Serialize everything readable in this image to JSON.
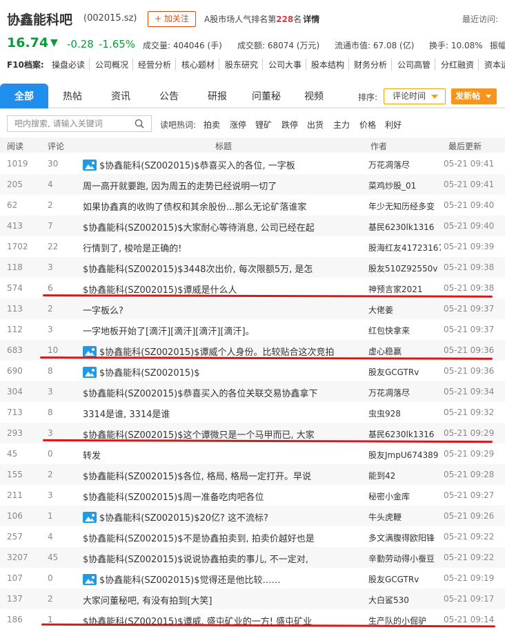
{
  "header": {
    "title": "协鑫能科吧",
    "code": "(002015.sz)",
    "follow_label": "+ 加关注",
    "rank_prefix": "A股市场人气排名第",
    "rank_num": "228",
    "rank_suffix": "名",
    "detail_label": "详情",
    "recent_visit": "最近访问:"
  },
  "quote": {
    "price": "16.74",
    "arrow": "▼",
    "change": "-0.28",
    "change_pct": "-1.65%",
    "volume": "成交量: 404046 (手)",
    "turnover": "成交额: 68074 (万元)",
    "float_cap": "流通市值: 67.08 (亿)",
    "turnover_rate": "换手: 10.08%",
    "amplitude": "振幅"
  },
  "f10": {
    "label": "F10档案:",
    "links": [
      "操盘必读",
      "公司概况",
      "经营分析",
      "核心题材",
      "股东研究",
      "公司大事",
      "股本结构",
      "财务分析",
      "公司高管",
      "分红融资",
      "资本运"
    ]
  },
  "tabs": [
    "全部",
    "热帖",
    "资讯",
    "公告",
    "研报",
    "问董秘",
    "视频"
  ],
  "sort": {
    "label": "排序:",
    "value": "评论时间",
    "post_label": "发新帖"
  },
  "search": {
    "placeholder": "吧内搜索, 请输入关键词",
    "hot_label": "读吧热词:",
    "hot_words": [
      "拍卖",
      "涨停",
      "锂矿",
      "跌停",
      "出货",
      "主力",
      "价格",
      "利好"
    ]
  },
  "table": {
    "headers": [
      "阅读",
      "评论",
      "标题",
      "作者",
      "最后更新"
    ],
    "rows": [
      {
        "read": "1019",
        "cmt": "30",
        "title": "$协鑫能科(SZ002015)$恭喜买入的各位, 一字板",
        "author": "万花凋落尽",
        "time": "05-21 09:41"
      },
      {
        "read": "205",
        "cmt": "4",
        "title": "周一高开就要跑, 因为周五的走势已经说明一切了",
        "author": "菜鸡炒股_01",
        "time": "05-21 09:41"
      },
      {
        "read": "62",
        "cmt": "2",
        "title": "如果协鑫真的收购了债权和其余股份...那么无论矿落谁家",
        "author": "年少无知历经多变",
        "time": "05-21 09:40"
      },
      {
        "read": "413",
        "cmt": "7",
        "title": "$协鑫能科(SZ002015)$大家耐心等待消息, 公司已经在起",
        "author": "基民6230lk1316",
        "time": "05-21 09:40"
      },
      {
        "read": "1702",
        "cmt": "22",
        "title": "行情到了, 梭哈是正确的!",
        "author": "股海红友41723167",
        "time": "05-21 09:39"
      },
      {
        "read": "118",
        "cmt": "3",
        "title": "$协鑫能科(SZ002015)$3448次出价, 每次限额5万, 是怎",
        "author": "股友510Z92550v",
        "time": "05-21 09:38"
      },
      {
        "read": "574",
        "cmt": "6",
        "title": "$协鑫能科(SZ002015)$谭威是什么人",
        "author": "神预言家2021",
        "time": "05-21 09:38"
      },
      {
        "read": "113",
        "cmt": "2",
        "title": "一字板么?",
        "author": "大佬姜",
        "time": "05-21 09:37"
      },
      {
        "read": "112",
        "cmt": "3",
        "title": "一字地板开始了[滴汗][滴汗][滴汗][滴汗]。",
        "author": "红包快拿来",
        "time": "05-21 09:37"
      },
      {
        "read": "683",
        "cmt": "10",
        "title": "$协鑫能科(SZ002015)$谭威个人身份。比较贴合这次竞拍",
        "author": "虚心稳赢",
        "time": "05-21 09:36"
      },
      {
        "read": "690",
        "cmt": "8",
        "title": "$协鑫能科(SZ002015)$",
        "author": "股友GCGTRv",
        "time": "05-21 09:36"
      },
      {
        "read": "304",
        "cmt": "3",
        "title": "$协鑫能科(SZ002015)$恭喜买入的各位关联交易协鑫拿下",
        "author": "万花凋落尽",
        "time": "05-21 09:34"
      },
      {
        "read": "713",
        "cmt": "8",
        "title": "3314是谁, 3314是谁",
        "author": "虫虫928",
        "time": "05-21 09:32"
      },
      {
        "read": "293",
        "cmt": "3",
        "title": "$协鑫能科(SZ002015)$这个谭微只是一个马甲而已, 大家",
        "author": "基民6230lk1316",
        "time": "05-21 09:29"
      },
      {
        "read": "45",
        "cmt": "0",
        "title": "转发",
        "author": "股友JmpU674389",
        "time": "05-21 09:29"
      },
      {
        "read": "155",
        "cmt": "2",
        "title": "$协鑫能科(SZ002015)$各位, 格局, 格局一定打开。早说",
        "author": "能到42",
        "time": "05-21 09:28"
      },
      {
        "read": "211",
        "cmt": "3",
        "title": "$协鑫能科(SZ002015)$周一准备吃肉吧各位",
        "author": "秘密小金库",
        "time": "05-21 09:27"
      },
      {
        "read": "106",
        "cmt": "1",
        "title": "$协鑫能科(SZ002015)$20亿? 这不流标?",
        "author": "牛头虎鞭",
        "time": "05-21 09:26"
      },
      {
        "read": "257",
        "cmt": "4",
        "title": "$协鑫能科(SZ002015)$不是协鑫拍卖到, 拍卖价越好也是",
        "author": "多文满腹得欧阳锋",
        "time": "05-21 09:22"
      },
      {
        "read": "3207",
        "cmt": "45",
        "title": "$协鑫能科(SZ002015)$说说协鑫拍卖的事儿, 不一定对,",
        "author": "辛勤劳动得小蚕豆",
        "time": "05-21 09:22"
      },
      {
        "read": "107",
        "cmt": "0",
        "title": "$协鑫能科(SZ002015)$觉得还是他比较……",
        "author": "股友GCGTRv",
        "time": "05-21 09:19"
      },
      {
        "read": "137",
        "cmt": "2",
        "title": "大家问董秘吧, 有没有拍到[大笑]",
        "author": "大白鲨530",
        "time": "05-21 09:17"
      },
      {
        "read": "186",
        "cmt": "1",
        "title": "$协鑫能科(SZ002015)$谭威, 盛屯矿业的一方! 盛屯矿业",
        "author": "生产队的小倔驴",
        "time": "05-21 09:14"
      }
    ]
  }
}
